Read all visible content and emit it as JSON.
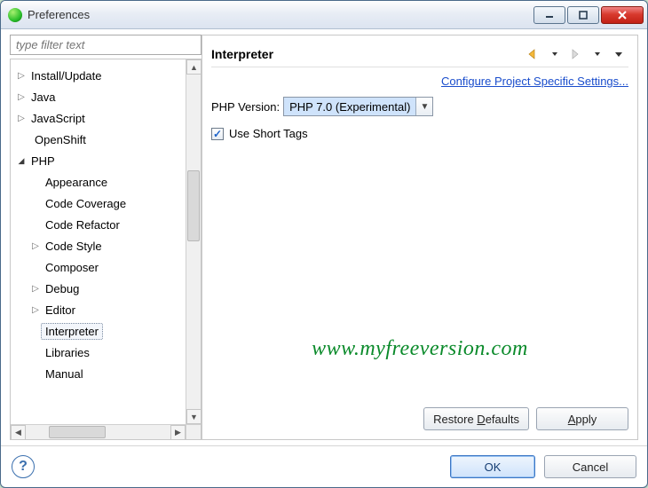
{
  "window": {
    "title": "Preferences"
  },
  "filter": {
    "placeholder": "type filter text"
  },
  "tree": {
    "items": [
      {
        "label": "Install/Update",
        "twisty": "right",
        "indent": 0
      },
      {
        "label": "Java",
        "twisty": "right",
        "indent": 0
      },
      {
        "label": "JavaScript",
        "twisty": "right",
        "indent": 0
      },
      {
        "label": "OpenShift",
        "twisty": "",
        "indent": 0,
        "noTwisty": true
      },
      {
        "label": "PHP",
        "twisty": "down",
        "indent": 0
      },
      {
        "label": "Appearance",
        "twisty": "",
        "indent": 1,
        "noTwisty": true
      },
      {
        "label": "Code Coverage",
        "twisty": "",
        "indent": 1,
        "noTwisty": true
      },
      {
        "label": "Code Refactor",
        "twisty": "",
        "indent": 1,
        "noTwisty": true
      },
      {
        "label": "Code Style",
        "twisty": "right",
        "indent": 1
      },
      {
        "label": "Composer",
        "twisty": "",
        "indent": 1,
        "noTwisty": true
      },
      {
        "label": "Debug",
        "twisty": "right",
        "indent": 1
      },
      {
        "label": "Editor",
        "twisty": "right",
        "indent": 1
      },
      {
        "label": "Interpreter",
        "twisty": "",
        "indent": 1,
        "noTwisty": true,
        "selected": true
      },
      {
        "label": "Libraries",
        "twisty": "",
        "indent": 1,
        "noTwisty": true
      },
      {
        "label": "Manual",
        "twisty": "",
        "indent": 1,
        "noTwisty": true
      }
    ]
  },
  "panel": {
    "title": "Interpreter",
    "configureLink": "Configure Project Specific Settings...",
    "phpVersionLabel": "PHP Version:",
    "phpVersionValue": "PHP 7.0 (Experimental)",
    "useShortTagsLabel": "Use Short Tags",
    "useShortTagsChecked": true,
    "watermark": "www.myfreeversion.com"
  },
  "buttons": {
    "restoreDefaults": "Restore Defaults",
    "apply": "Apply",
    "ok": "OK",
    "cancel": "Cancel"
  }
}
